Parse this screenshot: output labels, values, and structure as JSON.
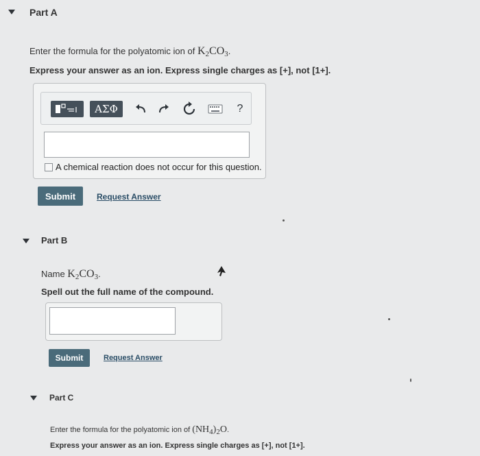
{
  "partA": {
    "title": "Part A",
    "prompt_prefix": "Enter the formula for the polyatomic ion of ",
    "compound": {
      "el1": "K",
      "sub1": "2",
      "el2": "CO",
      "sub2": "3"
    },
    "instruction": "Express your answer as an ion. Express single charges as [+], not [1+].",
    "toolbar": {
      "greek_label": "ΑΣΦ",
      "help_label": "?"
    },
    "answer_value": "",
    "no_reaction_label": "A chemical reaction does not occur for this question.",
    "submit_label": "Submit",
    "request_label": "Request Answer"
  },
  "partB": {
    "title": "Part B",
    "prompt_prefix": "Name ",
    "compound": {
      "el1": "K",
      "sub1": "2",
      "el2": "CO",
      "sub2": "3"
    },
    "instruction": "Spell out the full name of the compound.",
    "answer_value": "",
    "submit_label": "Submit",
    "request_label": "Request Answer"
  },
  "partC": {
    "title": "Part C",
    "prompt_prefix": "Enter the formula for the polyatomic ion of ",
    "compound": {
      "open": "(NH",
      "sub1": "4",
      "close": ")",
      "sub2": "2",
      "el": "O"
    },
    "instruction": "Express your answer as an ion. Express single charges as [+], not [1+]."
  }
}
